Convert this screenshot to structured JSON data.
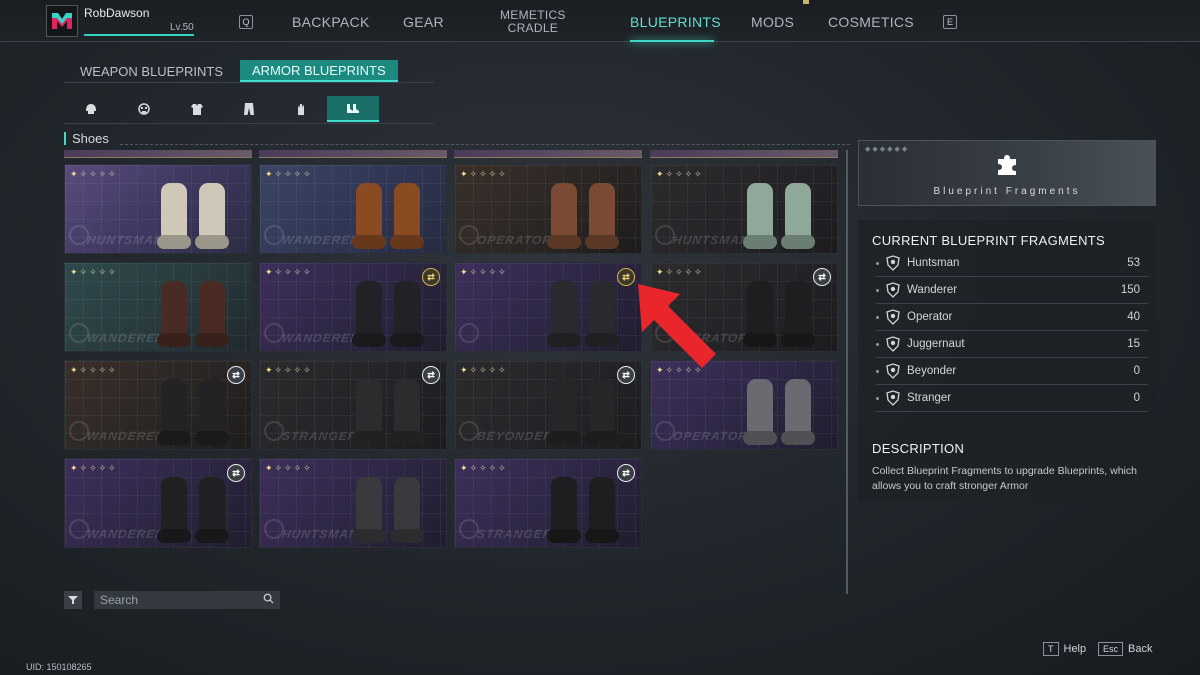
{
  "header": {
    "username": "RobDawson",
    "level": "Lv.50",
    "key_left": "Q",
    "key_right": "E",
    "tabs": [
      {
        "label": "BACKPACK"
      },
      {
        "label": "GEAR"
      },
      {
        "label_line1": "MEMETICS",
        "label_line2": "CRADLE"
      },
      {
        "label": "BLUEPRINTS"
      },
      {
        "label": "MODS"
      },
      {
        "label": "COSMETICS"
      }
    ],
    "active_tab": "BLUEPRINTS"
  },
  "subtabs": [
    {
      "label": "WEAPON BLUEPRINTS"
    },
    {
      "label": "ARMOR BLUEPRINTS"
    }
  ],
  "category_icons": [
    "helmet-icon",
    "mask-icon",
    "chest-armor-icon",
    "pants-icon",
    "gloves-icon",
    "shoes-icon"
  ],
  "section": {
    "label": "Shoes"
  },
  "blueprints": [
    {
      "brand": "HUNTSMAN",
      "stars": 5,
      "color": "purple",
      "boot_color": "#cfc8b8",
      "badge": ""
    },
    {
      "brand": "WANDERER",
      "stars": 5,
      "color": "blue",
      "boot_color": "#8a4a22",
      "badge": ""
    },
    {
      "brand": "OPERATOR",
      "stars": 5,
      "color": "dark",
      "boot_color": "#7a4a34",
      "badge": ""
    },
    {
      "brand": "HUNTSMAN",
      "stars": 5,
      "color": "dark2",
      "boot_color": "#8fa89a",
      "badge": ""
    },
    {
      "brand": "WANDERER",
      "stars": 5,
      "color": "teal",
      "boot_color": "#4a2a24",
      "badge": ""
    },
    {
      "brand": "WANDERER",
      "stars": 5,
      "color": "violet",
      "boot_color": "#222226",
      "badge": "gold"
    },
    {
      "brand": "",
      "stars": 5,
      "color": "violet",
      "boot_color": "#2a2a2e",
      "badge": "gold"
    },
    {
      "brand": "OPERATOR",
      "stars": 5,
      "color": "dark2",
      "boot_color": "#1e1e20",
      "badge": "white"
    },
    {
      "brand": "WANDERER",
      "stars": 5,
      "color": "dark",
      "boot_color": "#232326",
      "badge": "white"
    },
    {
      "brand": "STRANGER",
      "stars": 5,
      "color": "dark2",
      "boot_color": "#2c2c2e",
      "badge": "white"
    },
    {
      "brand": "BEYONDER",
      "stars": 5,
      "color": "dark2",
      "boot_color": "#262628",
      "badge": "white"
    },
    {
      "brand": "OPERATOR",
      "stars": 5,
      "color": "violet",
      "boot_color": "#6a6a70",
      "badge": ""
    },
    {
      "brand": "WANDERER",
      "stars": 5,
      "color": "violet",
      "boot_color": "#202022",
      "badge": "white"
    },
    {
      "brand": "HUNTSMAN",
      "stars": 5,
      "color": "violet",
      "boot_color": "#3a3a3e",
      "badge": ""
    },
    {
      "brand": "STRANGER",
      "stars": 5,
      "color": "violet",
      "boot_color": "#1e1e20",
      "badge": "white"
    }
  ],
  "search": {
    "placeholder": "Search"
  },
  "fragments_header": {
    "title": "Blueprint Fragments"
  },
  "fragments": {
    "heading": "CURRENT BLUEPRINT FRAGMENTS",
    "rows": [
      {
        "name": "Huntsman",
        "count": "53"
      },
      {
        "name": "Wanderer",
        "count": "150"
      },
      {
        "name": "Operator",
        "count": "40"
      },
      {
        "name": "Juggernaut",
        "count": "15"
      },
      {
        "name": "Beyonder",
        "count": "0"
      },
      {
        "name": "Stranger",
        "count": "0"
      }
    ]
  },
  "description": {
    "heading": "DESCRIPTION",
    "text": "Collect Blueprint Fragments to upgrade Blueprints, which allows you to craft stronger Armor"
  },
  "footer": {
    "help_key": "T",
    "help_label": "Help",
    "back_key": "Esc",
    "back_label": "Back",
    "uid": "UID: 150108265"
  },
  "colors": {
    "accent": "#3fd8c6",
    "arrow": "#e8262b",
    "gold_badge": "#d6b34a"
  }
}
